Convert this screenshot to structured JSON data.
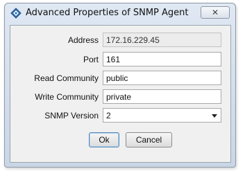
{
  "window": {
    "title": "Advanced Properties of SNMP Agent",
    "title_icon": "diamond-agent-icon",
    "close_glyph": "✕"
  },
  "form": {
    "address": {
      "label": "Address",
      "value": "172.16.229.45"
    },
    "port": {
      "label": "Port",
      "value": "161"
    },
    "read_community": {
      "label": "Read Community",
      "value": "public"
    },
    "write_community": {
      "label": "Write Community",
      "value": "private"
    },
    "snmp_version": {
      "label": "SNMP Version",
      "value": "2"
    }
  },
  "buttons": {
    "ok": "Ok",
    "cancel": "Cancel"
  },
  "colors": {
    "accent_blue": "#2f6db5",
    "title_gradient_top": "#dfe8f3",
    "title_gradient_bottom": "#c9d6e6"
  }
}
